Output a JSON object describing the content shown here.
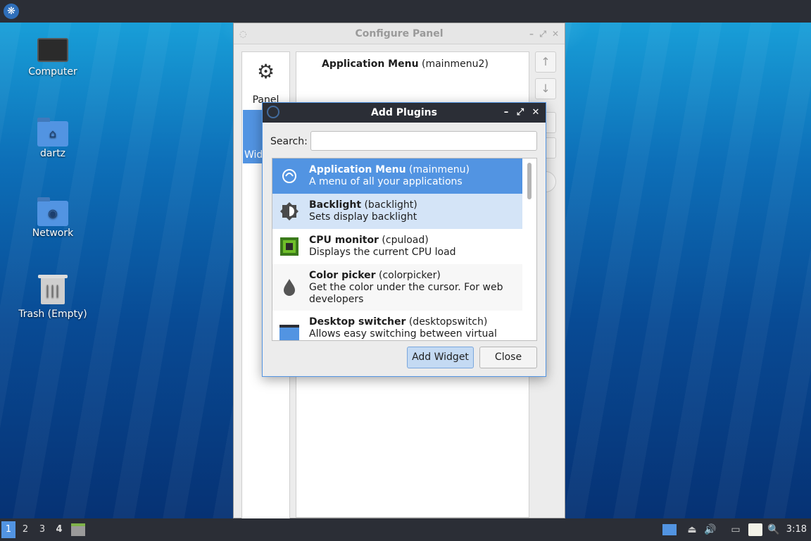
{
  "desktop": {
    "icons": [
      {
        "label": "Computer",
        "icon": "computer-icon"
      },
      {
        "label": "dartz",
        "icon": "home-folder-icon"
      },
      {
        "label": "Network",
        "icon": "network-folder-icon"
      },
      {
        "label": "Trash (Empty)",
        "icon": "trash-icon"
      }
    ]
  },
  "configure_panel": {
    "title": "Configure Panel",
    "sidebar": {
      "panel_label": "Panel",
      "widgets_label": "Widgets"
    },
    "widget_list": [
      {
        "name": "Application Menu",
        "id": "(mainmenu2)"
      }
    ],
    "buttons": {
      "up": "↑",
      "down": "↓"
    }
  },
  "add_plugins": {
    "title": "Add Plugins",
    "search": {
      "label": "Search:",
      "value": "",
      "placeholder": ""
    },
    "plugins": [
      {
        "name": "Application Menu",
        "id": "(mainmenu)",
        "desc": "A menu of all your applications",
        "icon": "application-menu-icon",
        "state": "selected"
      },
      {
        "name": "Backlight",
        "id": "(backlight)",
        "desc": "Sets display backlight",
        "icon": "backlight-icon",
        "state": "hover"
      },
      {
        "name": "CPU monitor",
        "id": "(cpuload)",
        "desc": "Displays the current CPU load",
        "icon": "cpu-monitor-icon",
        "state": "normal"
      },
      {
        "name": "Color picker",
        "id": "(colorpicker)",
        "desc": "Get the color under the cursor. For web developers",
        "icon": "color-picker-icon",
        "state": "alt"
      },
      {
        "name": "Desktop switcher",
        "id": "(desktopswitch)",
        "desc": "Allows easy switching between virtual",
        "icon": "desktop-switcher-icon",
        "state": "normal"
      }
    ],
    "add_button": "Add Widget",
    "close_button": "Close"
  },
  "taskbar": {
    "workspaces": [
      "1",
      "2",
      "3",
      "4"
    ],
    "active_workspace": "1",
    "clock": "3:18"
  },
  "colors": {
    "accent": "#5294e2",
    "panel_bg": "#2b2e36",
    "hover": "#d4e4f7"
  }
}
